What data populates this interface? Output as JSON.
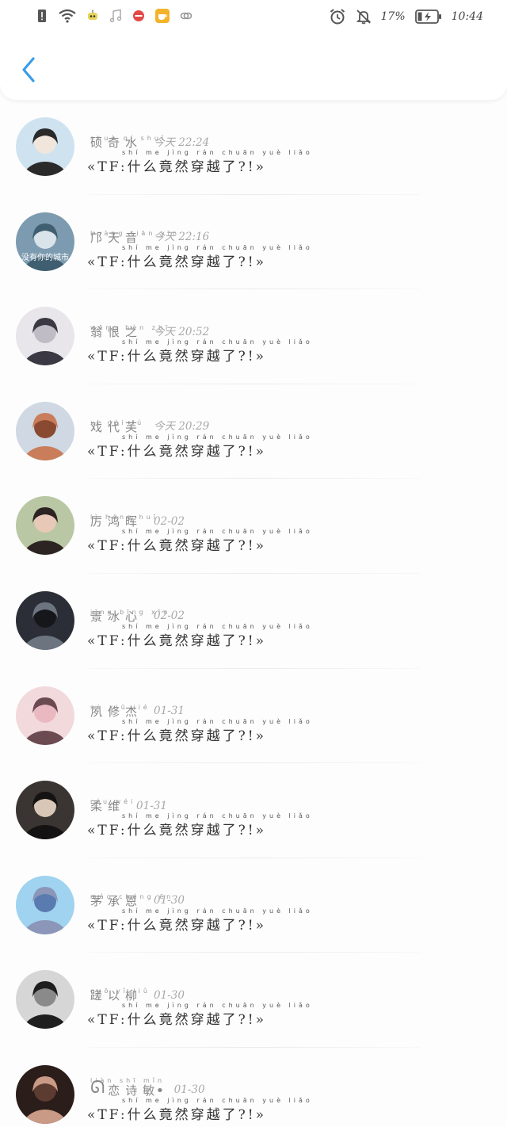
{
  "status_bar": {
    "battery": "17%",
    "time": "10:44",
    "left_icons": [
      "alert-icon",
      "wifi-icon",
      "robot-icon",
      "music-icon",
      "minus-badge-icon",
      "app-icon",
      "link-icon"
    ],
    "right_icons": [
      "alarm-icon",
      "mute-bell-icon",
      "battery-icon"
    ]
  },
  "header": {
    "back_icon": "chevron-left-icon",
    "accent": "#3a9de6"
  },
  "message_text": "«TF:什么竟然穿越了?!»",
  "message_pinyin": "shí  me  jìng rán chuān yuè liǎo",
  "contacts": [
    {
      "name": "硕奇水",
      "pinyin": "shuò qí shuǐ",
      "time": "今天 22:24",
      "avatar_colors": [
        "#cfe2f0",
        "#2a2a2a",
        "#f0e6dc"
      ]
    },
    {
      "name": "邝天音",
      "pinyin": "kuàng tiān yīn",
      "time": "今天 22:16",
      "avatar_colors": [
        "#7d9bb0",
        "#3f5e6f",
        "#d9e3ea"
      ],
      "avatar_caption": "没有你的城市"
    },
    {
      "name": "翁恨之",
      "pinyin": "wēng hèn zhī",
      "time": "今天 20:52",
      "avatar_colors": [
        "#e8e6ea",
        "#3a3842",
        "#bfbcc6"
      ]
    },
    {
      "name": "戏代芙",
      "pinyin": "xì dài fú",
      "time": "今天 20:29",
      "avatar_colors": [
        "#cfd8e3",
        "#c97d5a",
        "#8a4a32"
      ]
    },
    {
      "name": "厉鸿晖",
      "pinyin": "lì hóng huī",
      "time": "02-02",
      "avatar_colors": [
        "#b9c7a4",
        "#2c2422",
        "#e8c9b8"
      ]
    },
    {
      "name": "景冰心",
      "pinyin": "jǐng bīng xīn",
      "time": "02-02",
      "avatar_colors": [
        "#2b2e36",
        "#6c7480",
        "#15171b"
      ]
    },
    {
      "name": "夙修杰",
      "pinyin": "sù xiū jié",
      "time": "01-31",
      "avatar_colors": [
        "#f2d9dc",
        "#6b4a52",
        "#e9b8c0"
      ]
    },
    {
      "name": "柔维",
      "pinyin": "róu wéi",
      "time": "01-31",
      "avatar_colors": [
        "#3a3532",
        "#141212",
        "#d8c7b6"
      ]
    },
    {
      "name": "茅承恩",
      "pinyin": "máo chéng ēn",
      "time": "01-30",
      "avatar_colors": [
        "#9fd3f0",
        "#8c96b8",
        "#5a7bb0"
      ]
    },
    {
      "name": "蹉以柳",
      "pinyin": "cuō yǐ liǔ",
      "time": "01-30",
      "avatar_colors": [
        "#d6d6d6",
        "#1e1e1e",
        "#8a8a8a"
      ]
    },
    {
      "name": "恋诗敏",
      "pinyin": "liàn shī mǐn",
      "time": "01-30",
      "avatar_colors": [
        "#2a1d1a",
        "#c99a85",
        "#5c3b30"
      ],
      "name_prefix": "ᘏ",
      "name_suffix": "ꔷ"
    }
  ]
}
